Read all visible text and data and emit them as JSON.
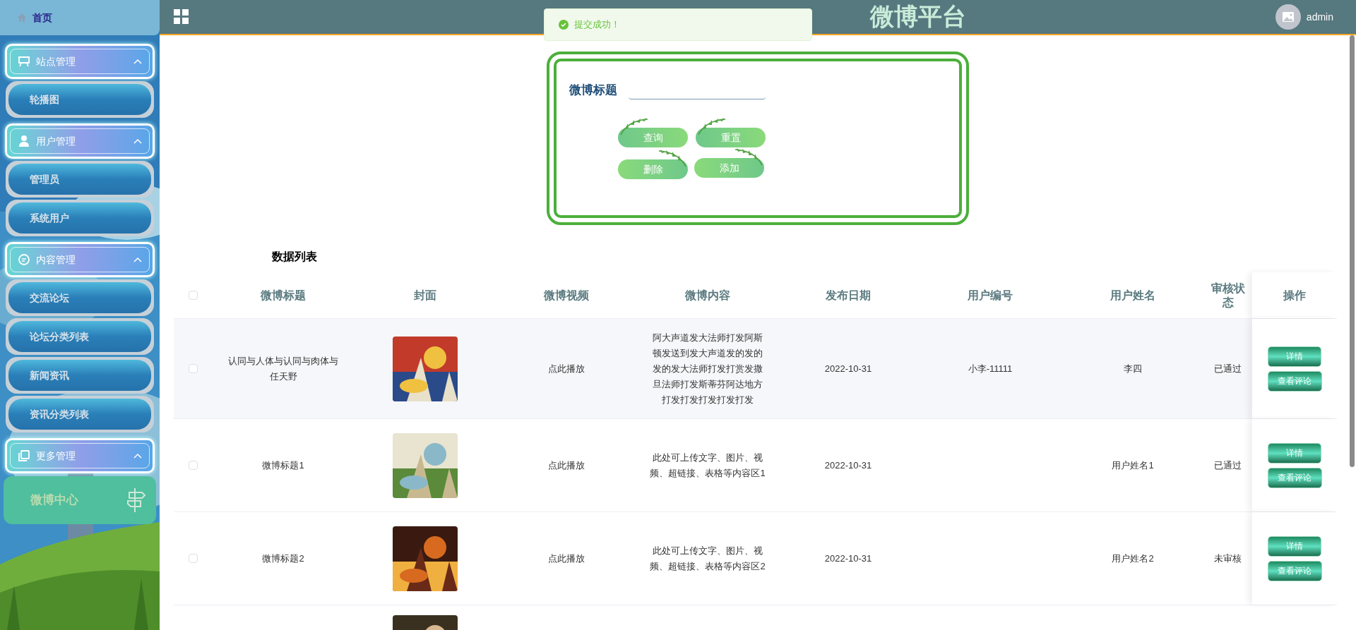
{
  "sidebar": {
    "home": {
      "label": "首页"
    },
    "groups": [
      {
        "label": "站点管理",
        "expanded": true,
        "children": [
          {
            "label": "轮播图",
            "selected": false
          }
        ]
      },
      {
        "label": "用户管理",
        "expanded": true,
        "children": [
          {
            "label": "管理员",
            "selected": false
          },
          {
            "label": "系统用户",
            "selected": false
          }
        ]
      },
      {
        "label": "内容管理",
        "expanded": true,
        "children": [
          {
            "label": "交流论坛",
            "selected": false
          },
          {
            "label": "论坛分类列表",
            "selected": false
          },
          {
            "label": "新闻资讯",
            "selected": false
          },
          {
            "label": "资讯分类列表",
            "selected": false
          }
        ]
      },
      {
        "label": "更多管理",
        "expanded": true,
        "children": [
          {
            "label": "微博中心",
            "selected": true
          }
        ]
      }
    ]
  },
  "header": {
    "title": "微博平台",
    "user": "admin"
  },
  "toast": {
    "message": "提交成功！"
  },
  "search": {
    "label": "微博标题",
    "buttons": [
      "查询",
      "重置",
      "删除",
      "添加"
    ]
  },
  "table": {
    "title": "数据列表",
    "select_all": false,
    "columns": [
      "微博标题",
      "封面",
      "微博视频",
      "微博内容",
      "发布日期",
      "用户编号",
      "用户姓名",
      "审核状态",
      "操作"
    ],
    "rows": [
      {
        "checked": false,
        "title": "认同与人体与认同与肉体与任天野",
        "cover": {
          "kind": "picture"
        },
        "video": "点此播放",
        "content": "阿大声道发大法师打发阿斯顿发送到发大声道发的发的发的发大法师打发打赏发撒旦法师打发斯蒂芬阿达地方打发打发打发打发打发",
        "date": "2022-10-31",
        "user_no": "小李-11111",
        "user_name": "李四",
        "status": "已通过",
        "actions": [
          "详情",
          "查看评论"
        ]
      },
      {
        "checked": false,
        "title": "微博标题1",
        "cover": {
          "kind": "picture"
        },
        "video": "点此播放",
        "content": "此处可上传文字、图片、视频、超链接、表格等内容区1",
        "date": "2022-10-31",
        "user_name": "用户姓名1",
        "status": "已通过",
        "actions": [
          "详情",
          "查看评论"
        ]
      },
      {
        "checked": false,
        "title": "微博标题2",
        "cover": {
          "kind": "picture"
        },
        "video": "点此播放",
        "content": "此处可上传文字、图片、视频、超链接、表格等内容区2",
        "date": "2022-10-31",
        "user_name": "用户姓名2",
        "status": "未审核",
        "actions": [
          "详情",
          "查看评论"
        ]
      },
      {
        "cover": {
          "kind": "picture"
        }
      }
    ]
  }
}
